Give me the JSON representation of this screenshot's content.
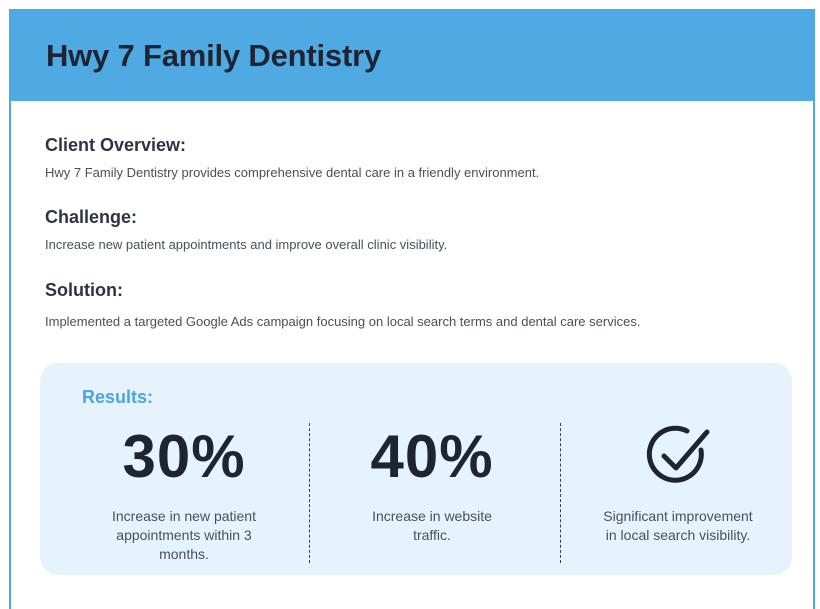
{
  "header": {
    "title": "Hwy 7 Family Dentistry"
  },
  "sections": [
    {
      "heading": "Client Overview:",
      "body": "Hwy 7 Family Dentistry provides comprehensive dental care in a friendly environment."
    },
    {
      "heading": "Challenge:",
      "body": "Increase new patient appointments and improve overall clinic visibility."
    },
    {
      "heading": "Solution:",
      "body": "Implemented a targeted Google Ads campaign focusing on local search terms and dental care services."
    }
  ],
  "results": {
    "title": "Results:",
    "stats": [
      {
        "value": "30%",
        "caption": "Increase in new patient appointments within 3 months."
      },
      {
        "value": "40%",
        "caption": "Increase in website traffic."
      },
      {
        "icon": "check-circle-icon",
        "caption": "Significant improvement in local search visibility."
      }
    ]
  },
  "colors": {
    "header_bg": "#4fa9e3",
    "accent": "#4aa6e0",
    "results_bg": "#e6f3fc",
    "text_dark": "#1f2433"
  }
}
